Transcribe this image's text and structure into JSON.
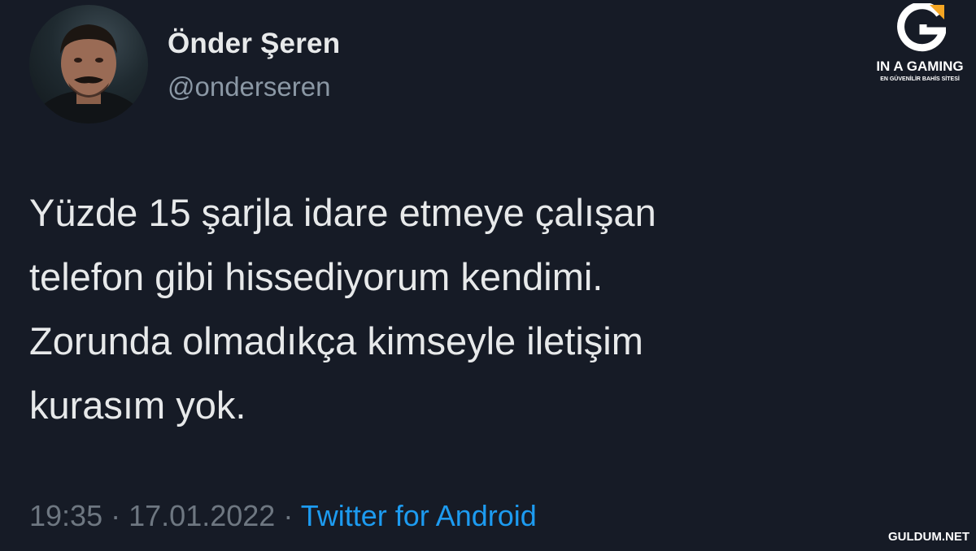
{
  "tweet": {
    "author": {
      "name": "Önder Şeren",
      "handle": "@onderseren"
    },
    "text": "Yüzde 15 şarjla idare etmeye çalışan\ntelefon gibi hissediyorum kendimi.\nZorunda olmadıkça kimseyle iletişim\nkurasım yok.",
    "time": "19:35",
    "separator": "·",
    "date": "17.01.2022",
    "source": "Twitter for Android"
  },
  "watermark": {
    "brand": "IN A GAMING",
    "tagline": "EN GÜVENİLİR BAHİS SİTESİ",
    "site": "GULDUM.NET"
  },
  "colors": {
    "background": "#161b26",
    "text": "#e7e9ea",
    "secondary_text": "#8b98a5",
    "link": "#1d9bf0",
    "logo_accent": "#f5a623"
  }
}
